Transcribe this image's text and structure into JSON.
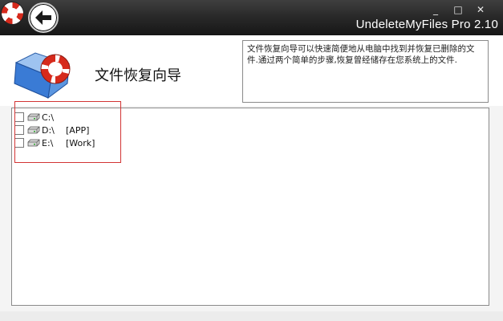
{
  "titlebar": {
    "app_title": "UndeleteMyFiles Pro 2.10",
    "icons": {
      "logo": "lifebuoy-icon",
      "back": "back-arrow-icon"
    },
    "controls": {
      "minimize": "_",
      "maximize": "□",
      "close": "✕"
    }
  },
  "header": {
    "title": "文件恢复向导",
    "description": "文件恢复向导可以快速简便地从电脑中找到并恢复已删除的文件.通过两个简单的步骤,恢复曾经储存在您系统上的文件."
  },
  "drives": [
    {
      "letter": "C:\\",
      "label": ""
    },
    {
      "letter": "D:\\",
      "label": "[APP]"
    },
    {
      "letter": "E:\\",
      "label": "[Work]"
    }
  ],
  "colors": {
    "titlebar": "#222222",
    "lifebuoy_red": "#d62a1c",
    "highlight": "#d23434",
    "folder_blue": "#3a7bd5"
  }
}
